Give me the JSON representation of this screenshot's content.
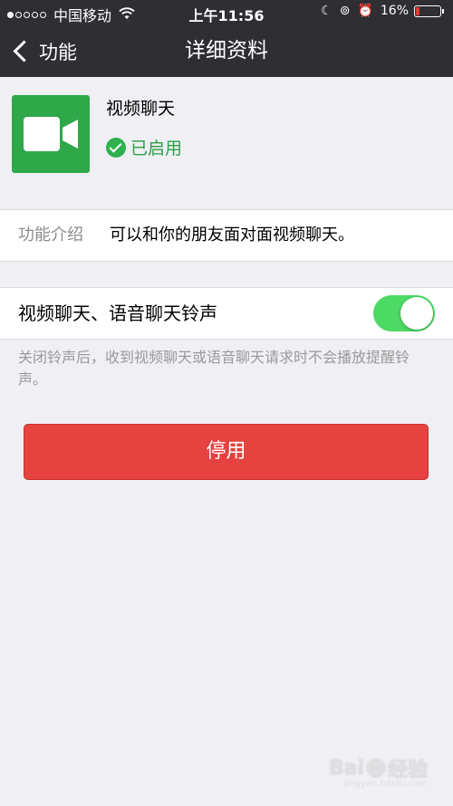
{
  "status_bar": {
    "carrier": "中国移动",
    "time": "上午11:56",
    "battery_percent": "16%",
    "battery_level": 0.16,
    "battery_color": "#e53935",
    "signal_strength": 1,
    "icons": [
      "wifi-icon",
      "moon-icon",
      "rotation-lock-icon",
      "alarm-icon",
      "battery-icon"
    ]
  },
  "nav": {
    "back_label": "功能",
    "title": "详细资料"
  },
  "profile": {
    "app_name": "视频聊天",
    "status": "已启用",
    "icon": "video-camera-icon",
    "icon_bg": "#2fa84a"
  },
  "intro": {
    "label": "功能介绍",
    "value": "可以和你的朋友面对面视频聊天。"
  },
  "ringtone": {
    "label": "视频聊天、语音聊天铃声",
    "enabled": true,
    "hint": "关闭铃声后，收到视频聊天或语音聊天请求时不会播放提醒铃声。"
  },
  "actions": {
    "disable_label": "停用",
    "disable_color": "#e64340"
  },
  "watermark": {
    "brand": "Bai",
    "brand_suffix": "经验",
    "url": "jingyan.baidu.com"
  }
}
